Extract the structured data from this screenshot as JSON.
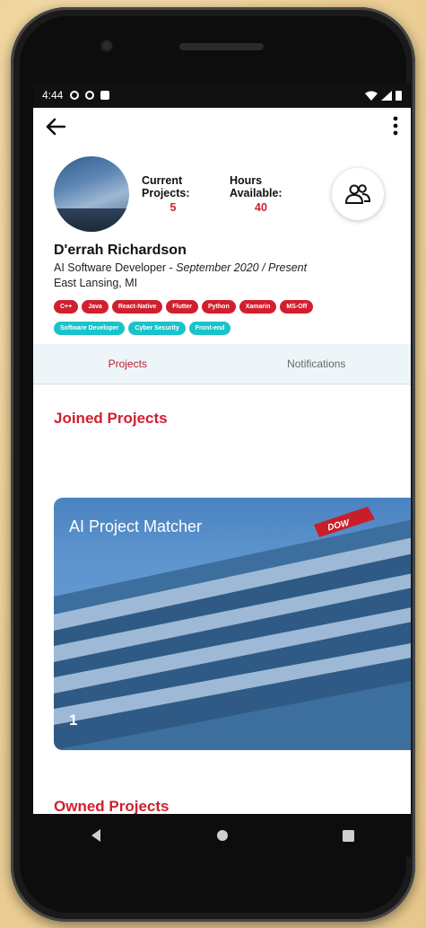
{
  "status_bar": {
    "time": "4:44"
  },
  "profile": {
    "name": "D'errah Richardson",
    "role": "AI Software Developer - ",
    "role_period": "September 2020 / Present",
    "location": "East Lansing, MI",
    "current_projects_label_1": "Current",
    "current_projects_label_2": "Projects:",
    "current_projects_value": "5",
    "hours_label_1": "Hours",
    "hours_label_2": "Available:",
    "hours_value": "40"
  },
  "skills": [
    "C++",
    "Java",
    "React-Native",
    "Flutter",
    "Python",
    "Xamarin",
    "MS-Off"
  ],
  "interests": [
    "Software Developer",
    "Cyber Security",
    "Front-end"
  ],
  "tabs": {
    "projects": "Projects",
    "notifications": "Notifications"
  },
  "sections": {
    "joined": "Joined Projects",
    "owned": "Owned Projects"
  },
  "joined_project": {
    "title": "AI Project Matcher",
    "badge": "DOW",
    "count": "1"
  },
  "colors": {
    "accent": "#d11f2e",
    "teal": "#19c3c9",
    "tab_bg": "#eef5f9"
  },
  "icons": [
    "back-arrow-icon",
    "more-vert-icon",
    "people-icon",
    "nav-back-icon",
    "nav-home-icon",
    "nav-recents-icon"
  ]
}
